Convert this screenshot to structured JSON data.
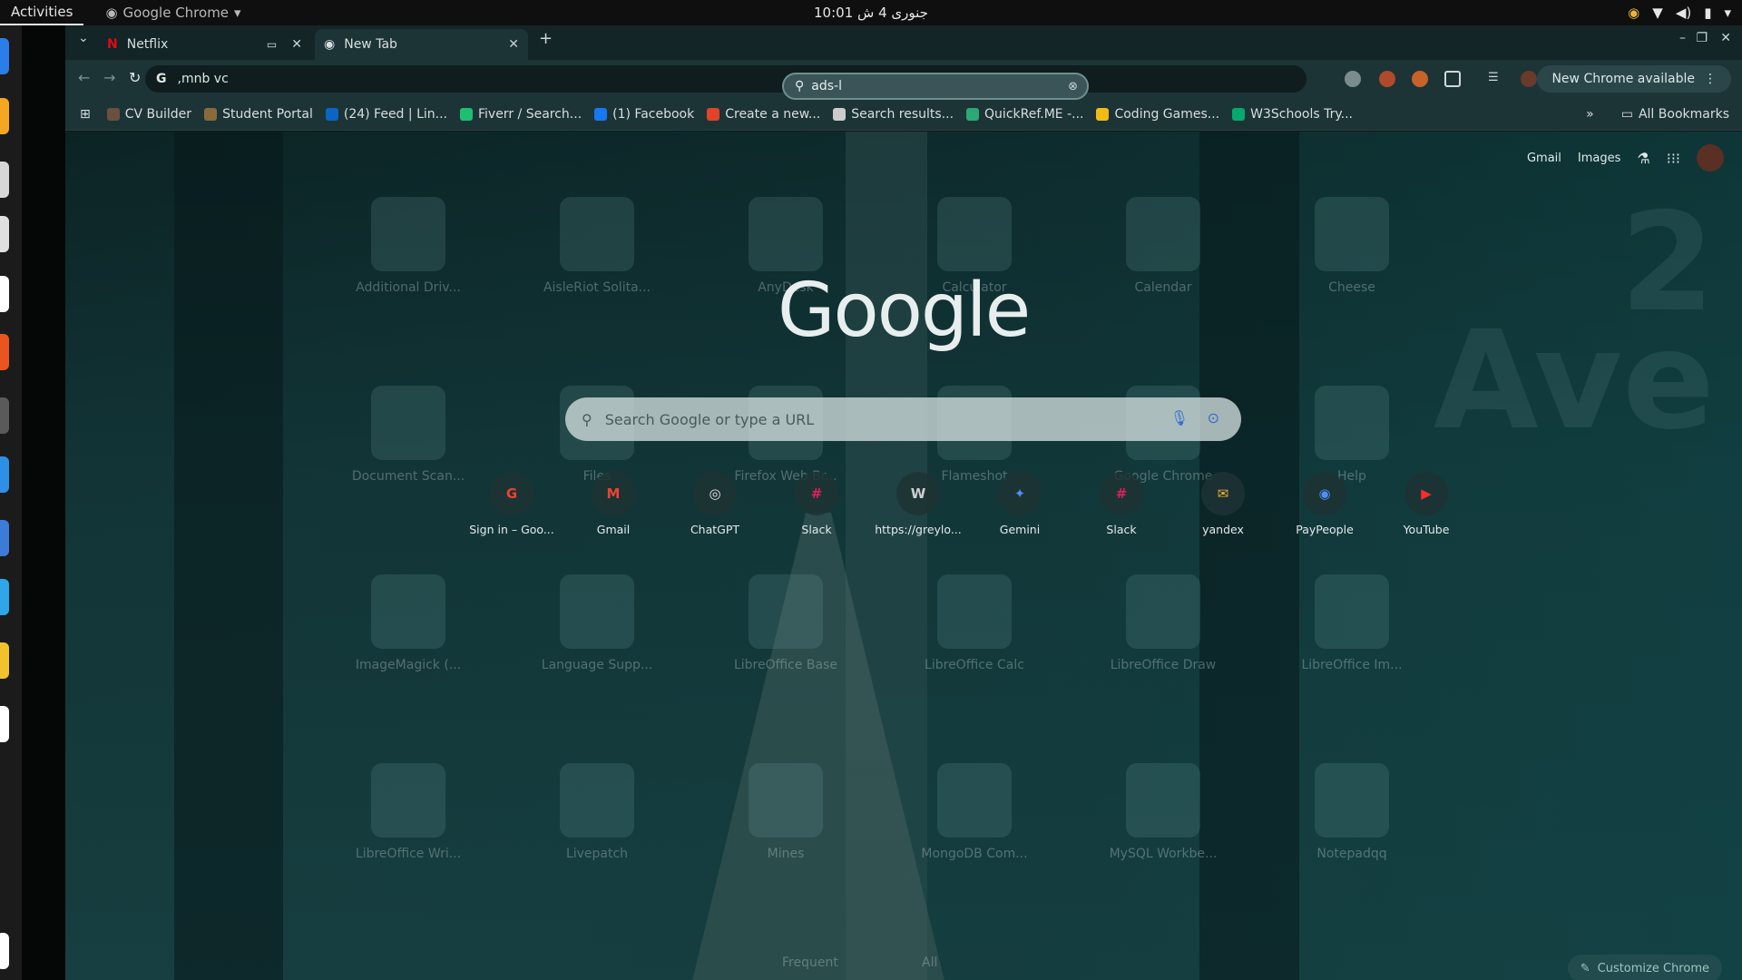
{
  "topbar": {
    "activities": "Activities",
    "app_name": "Google Chrome",
    "clock": "10:01 جنوری 4 ش"
  },
  "tabs": [
    {
      "label": "Netflix"
    },
    {
      "label": "New Tab"
    }
  ],
  "omnibox": {
    "value": ",mnb vc"
  },
  "find": {
    "value": "ads-l"
  },
  "toolbar": {
    "new_chrome": "New Chrome available"
  },
  "bookmarks": [
    {
      "label": "CV Builder",
      "color": "#6b4f3f"
    },
    {
      "label": "Student Portal",
      "color": "#8a6a3a"
    },
    {
      "label": "(24) Feed | Lin...",
      "color": "#0a66c2"
    },
    {
      "label": "Fiverr / Search...",
      "color": "#1dbf73"
    },
    {
      "label": "(1) Facebook",
      "color": "#1877f2"
    },
    {
      "label": "Create a new...",
      "color": "#e24329"
    },
    {
      "label": "Search results...",
      "color": "#cccccc"
    },
    {
      "label": "QuickRef.ME -...",
      "color": "#2aa876"
    },
    {
      "label": "Coding Games...",
      "color": "#f2bb13"
    },
    {
      "label": "W3Schools Try...",
      "color": "#04aa6d"
    }
  ],
  "all_bookmarks": "All Bookmarks",
  "ntp": {
    "gmail": "Gmail",
    "images": "Images",
    "logo": "Google",
    "search_placeholder": "Search Google or type a URL",
    "shortcuts": [
      {
        "label": "Sign in – Goo...",
        "glyph": "G",
        "color": "#ea4335"
      },
      {
        "label": "Gmail",
        "glyph": "M",
        "color": "#ea4335"
      },
      {
        "label": "ChatGPT",
        "glyph": "◎",
        "color": "#e6e6e6"
      },
      {
        "label": "Slack",
        "glyph": "#",
        "color": "#e01e5a"
      },
      {
        "label": "https://greylo...",
        "glyph": "W",
        "color": "#cfcfcf"
      },
      {
        "label": "Gemini",
        "glyph": "✦",
        "color": "#4e8cf7"
      },
      {
        "label": "Slack",
        "glyph": "#",
        "color": "#e01e5a"
      },
      {
        "label": "yandex",
        "glyph": "✉",
        "color": "#f2b233"
      },
      {
        "label": "PayPeople",
        "glyph": "◉",
        "color": "#4f8ff7"
      },
      {
        "label": "YouTube",
        "glyph": "▶",
        "color": "#ff2b2b"
      }
    ],
    "faded_tab_frequent": "Frequent",
    "faded_tab_all": "All",
    "customize": "Customize Chrome"
  },
  "launcher_apps": [
    "Additional Driv...",
    "AisleRiot Solita...",
    "AnyDesk",
    "Calculator",
    "Calendar",
    "Cheese",
    "Document Scan...",
    "Files",
    "Firefox Web Br...",
    "Flameshot",
    "Google Chrome",
    "Help",
    "ImageMagick (...",
    "Language Supp...",
    "LibreOffice Base",
    "LibreOffice Calc",
    "LibreOffice Draw",
    "LibreOffice Im...",
    "LibreOffice Wri...",
    "Livepatch",
    "Mines",
    "MongoDB Com...",
    "MySQL Workbe...",
    "Notepadqq"
  ],
  "wallpaper_text": {
    "line1": "2",
    "line2": "Ave"
  },
  "colors": {
    "accent": "#1d3437",
    "search_bg": "#d2dede"
  }
}
